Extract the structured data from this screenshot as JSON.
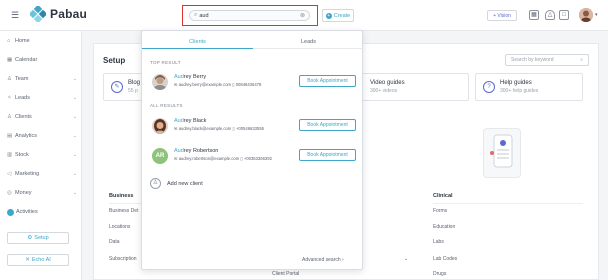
{
  "brand": {
    "name": "Pabau",
    "accent": "#3ea6c9",
    "highlight_border": "#e0312f"
  },
  "topbar": {
    "menu_icon": "hamburger-icon",
    "search": {
      "value": "aud",
      "icon": "search-icon",
      "clear_icon": "clear-icon"
    },
    "create_label": "Create",
    "vision_label": "+ Vision",
    "icons": [
      "calendar-icon",
      "bell-icon",
      "chat-icon"
    ]
  },
  "sidebar": {
    "items": [
      {
        "label": "Home",
        "icon": "home-icon",
        "chevron": false
      },
      {
        "label": "Calendar",
        "icon": "calendar-icon",
        "chevron": false
      },
      {
        "label": "Team",
        "icon": "team-icon",
        "chevron": true
      },
      {
        "label": "Leads",
        "icon": "leads-icon",
        "chevron": true
      },
      {
        "label": "Clients",
        "icon": "clients-icon",
        "chevron": true
      },
      {
        "label": "Analytics",
        "icon": "analytics-icon",
        "chevron": true
      },
      {
        "label": "Stock",
        "icon": "stock-icon",
        "chevron": true
      },
      {
        "label": "Marketing",
        "icon": "marketing-icon",
        "chevron": true
      },
      {
        "label": "Money",
        "icon": "money-icon",
        "chevron": true
      },
      {
        "label": "Activities",
        "icon": "activities-icon",
        "chevron": false
      }
    ],
    "setup_label": "Setup",
    "echo_label": "Echo AI"
  },
  "main": {
    "title": "Setup",
    "kb_search_placeholder": "Search by keyword",
    "cards": [
      {
        "title": "Blog",
        "sub": "55 p"
      },
      {
        "title": "Video guides",
        "sub": "300+ videos"
      },
      {
        "title": "Help guides",
        "sub": "300+ help guides"
      }
    ],
    "business": {
      "title": "Business",
      "items": [
        "Business Det",
        "Locations",
        "Data",
        "Subscription"
      ]
    },
    "middle_items": [
      "Client Portal"
    ],
    "clinical": {
      "title": "Clinical",
      "items": [
        "Forms",
        "Education",
        "Labs",
        "Lab Codes",
        "Drugs"
      ]
    }
  },
  "dropdown": {
    "tabs": [
      {
        "label": "Clients",
        "active": true
      },
      {
        "label": "Leads",
        "active": false
      }
    ],
    "top_result_label": "TOP RESULT",
    "all_results_label": "ALL RESULTS",
    "top_result": {
      "name_highlight": "Aud",
      "name_rest": "rey Berry",
      "email": "audrey.berry@example.com",
      "phone": "00846435478",
      "action": "Book Appointment"
    },
    "all_results": [
      {
        "name_highlight": "Aud",
        "name_rest": "rey Black",
        "email": "audrey.black@example.com",
        "phone": "+00546633555",
        "action": "Book Appointment",
        "avatar": "photo"
      },
      {
        "name_highlight": "Aud",
        "name_rest": "rey Robertson",
        "email": "audrey.robertson@example.com",
        "phone": "+00353366392",
        "action": "Book Appointment",
        "avatar": "AR",
        "avatar_color": "#8fc27a"
      }
    ],
    "add_label": "Add new client",
    "advanced_label": "Advanced search"
  }
}
